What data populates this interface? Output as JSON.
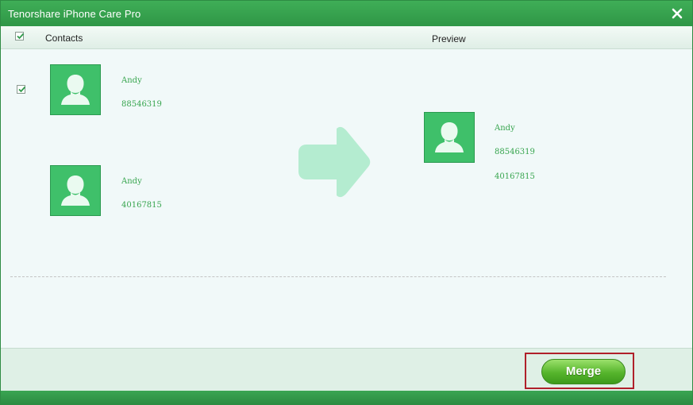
{
  "window": {
    "title": "Tenorshare iPhone Care Pro"
  },
  "header": {
    "contacts_label": "Contacts",
    "preview_label": "Preview",
    "select_all_checked": true
  },
  "source_contacts": [
    {
      "name": "Andy",
      "phone": "88546319",
      "checked": true
    },
    {
      "name": "Andy",
      "phone": "40167815"
    }
  ],
  "preview_contact": {
    "name": "Andy",
    "phones": [
      "88546319",
      "40167815"
    ]
  },
  "footer": {
    "merge_label": "Merge"
  },
  "colors": {
    "titlebar": "#34a04d",
    "avatar": "#3fc06a",
    "contact_text": "#37a54e",
    "arrow": "#b4ecd0",
    "merge_button": "#56b52c",
    "highlight_box": "#b0202a"
  },
  "icons": {
    "close": "close-icon",
    "avatar": "person-silhouette-icon",
    "arrow": "right-arrow-icon",
    "check": "check-icon"
  }
}
